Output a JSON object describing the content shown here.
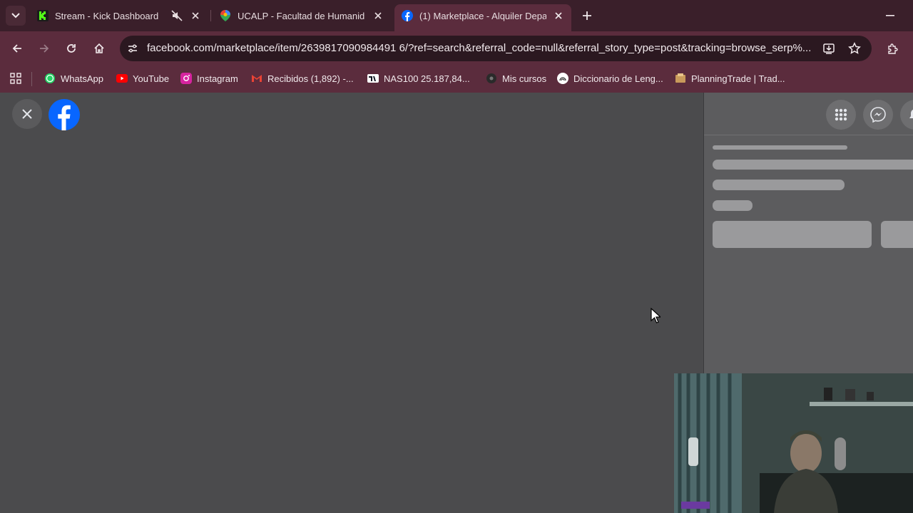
{
  "tabs": [
    {
      "title": "Stream - Kick Dashboard",
      "muted": true
    },
    {
      "title": "UCALP - Facultad de Humanida"
    },
    {
      "title": "(1) Marketplace - Alquiler Depa",
      "active": true
    }
  ],
  "address_bar": {
    "url": "facebook.com/marketplace/item/2639817090984491 6/?ref=search&referral_code=null&referral_story_type=post&tracking=browse_serp%..."
  },
  "bookmarks": [
    {
      "label": "WhatsApp",
      "icon": "whatsapp-icon"
    },
    {
      "label": "YouTube",
      "icon": "youtube-icon"
    },
    {
      "label": "Instagram",
      "icon": "instagram-icon"
    },
    {
      "label": "Recibidos (1,892) -...",
      "icon": "gmail-icon"
    },
    {
      "label": "NAS100 25.187,84...",
      "icon": "tradingview-icon"
    },
    {
      "label": "Mis cursos",
      "icon": "course-icon"
    },
    {
      "label": "Diccionario de Leng...",
      "icon": "rae-icon"
    },
    {
      "label": "PlanningTrade | Trad...",
      "icon": "planningtrade-icon"
    }
  ],
  "colors": {
    "tabbar": "#3a1f2a",
    "toolbar": "#5b2c3d",
    "content_bg": "#4b4b4d",
    "facebook_blue": "#0866ff"
  }
}
